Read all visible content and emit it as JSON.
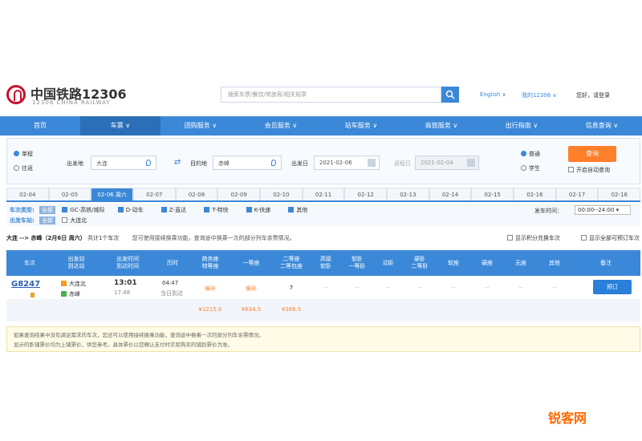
{
  "header": {
    "brand_cn": "中国铁路12306",
    "brand_en": "12306 CHINA RAILWAY",
    "search_placeholder": "搜索车票/餐饮/常旅客/相关规章",
    "links": [
      "English ∨",
      "我的12306 ∨",
      "您好，请登录"
    ]
  },
  "nav": {
    "items": [
      "首页",
      "车票 ∨",
      "团购服务 ∨",
      "会员服务 ∨",
      "站车服务 ∨",
      "商旅服务 ∨",
      "出行指南 ∨",
      "信息查询 ∨"
    ],
    "active_index": 1
  },
  "query": {
    "trip_types": [
      "单程",
      "往返"
    ],
    "selected_trip": "单程",
    "from_label": "出发地",
    "from_value": "大连",
    "to_label": "目的地",
    "to_value": "赤峰",
    "depart_label": "出发日",
    "depart_value": "2021-02-06",
    "return_label": "返程日",
    "return_value": "2021-02-04",
    "passenger_types": [
      "普通",
      "学生"
    ],
    "selected_passenger": "普通",
    "query_button": "查询",
    "auto_query": "开启自动查询"
  },
  "dates": {
    "tabs": [
      "02-04",
      "02-05",
      "02-06 周六",
      "02-07",
      "02-08",
      "02-09",
      "02-10",
      "02-11",
      "02-12",
      "02-13",
      "02-14",
      "02-15",
      "02-16",
      "02-17",
      "02-18"
    ],
    "active_index": 2
  },
  "filters": {
    "type_label": "车次类型:",
    "all_label": "全部",
    "types": [
      "GC-高铁/城际",
      "D-动车",
      "Z-直达",
      "T-特快",
      "K-快速",
      "其他"
    ],
    "station_label": "出发车站:",
    "stations": [
      "大连北"
    ],
    "time_label": "发车时间：",
    "time_value": "00:00--24:00"
  },
  "result": {
    "route": "大连 --> 赤峰（2月6日 周六）",
    "count": "共计1个车次",
    "note": "您可使用接续换乘功能，查询途中换乘一次的部分列车余票情况。",
    "check1": "显示积分兑换车次",
    "check2": "显示全部可预订车次"
  },
  "table": {
    "headers": [
      "车次",
      "出发站\n到达站",
      "出发时间\n到达时间",
      "历时",
      "商务座\n特等座",
      "一等座",
      "二等座\n二等包座",
      "高级\n软卧",
      "软卧\n一等卧",
      "动卧",
      "硬卧\n二等卧",
      "软座",
      "硬座",
      "无座",
      "其他",
      "备注"
    ],
    "row": {
      "train_no": "G8247",
      "from_station": "大连北",
      "to_station": "赤峰",
      "depart_time": "13:01",
      "arrive_time": "17:48",
      "duration": "04:47",
      "duration_note": "当日到达",
      "business": "候补",
      "first": "候补",
      "second": "7",
      "dash": "--",
      "book": "预订"
    },
    "prices": {
      "business": "¥1215.0",
      "first": "¥634.5",
      "second": "¥386.5"
    }
  },
  "notice": {
    "line1": "如果查询结果中没有满足需求的车次，您还可以使用接续换乘功能，查询途中换乘一次的部分列车余票情况。",
    "line2": "显示的卧铺票价均为上铺票价，供您参考。具体票价以您确认支付时实际购买的铺别票价为准。"
  },
  "watermark": "锐客网",
  "colors": {
    "primary": "#3b88d8",
    "accent": "#ff7f2a"
  }
}
